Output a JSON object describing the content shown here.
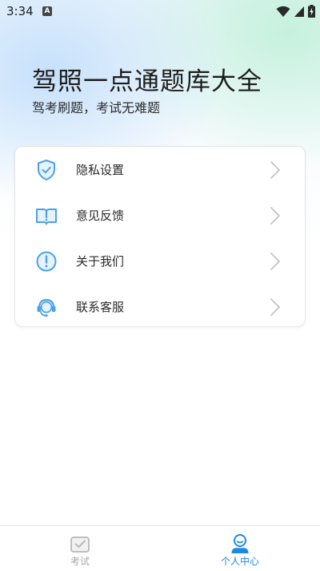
{
  "status_bar": {
    "time": "3:34",
    "badge": "A"
  },
  "header": {
    "title": "驾照一点通题库大全",
    "subtitle": "驾考刷题，考试无难题"
  },
  "menu": {
    "items": [
      {
        "label": "隐私设置",
        "icon": "shield-check-icon"
      },
      {
        "label": "意见反馈",
        "icon": "feedback-book-icon"
      },
      {
        "label": "关于我们",
        "icon": "info-exclamation-icon"
      },
      {
        "label": "联系客服",
        "icon": "headset-icon"
      }
    ]
  },
  "bottom_nav": {
    "tabs": [
      {
        "label": "考试",
        "icon": "exam-checkbox-icon",
        "active": false
      },
      {
        "label": "个人中心",
        "icon": "user-profile-icon",
        "active": true
      }
    ]
  },
  "colors": {
    "accent": "#1e88e5",
    "icon_blue": "#4aa3e8",
    "inactive": "#a9a9a9"
  }
}
